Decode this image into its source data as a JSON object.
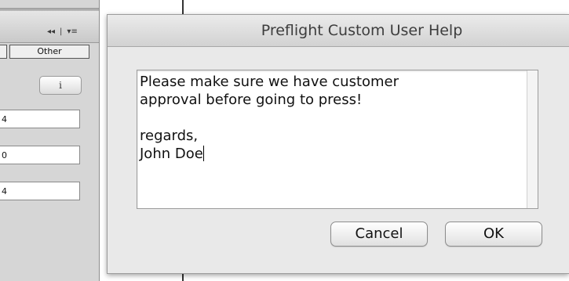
{
  "panel": {
    "collapse_icon_glyph": "◂◂",
    "separator_glyph": "|",
    "menu_icon_glyph": "▾≡",
    "tab_other_label": "Other",
    "info_button_label": "i",
    "fields": [
      "4",
      "0",
      "4"
    ]
  },
  "dialog": {
    "title": "Preflight Custom User Help",
    "message_lines": [
      "Please make sure we have customer",
      "approval before going to press!",
      "",
      "regards,",
      "John Doe"
    ],
    "cancel_label": "Cancel",
    "ok_label": "OK"
  }
}
